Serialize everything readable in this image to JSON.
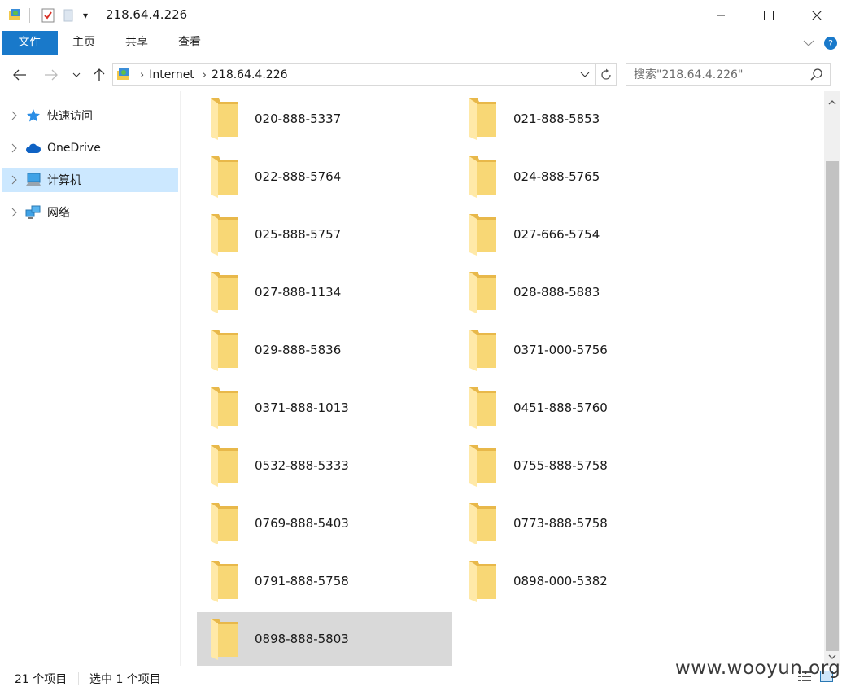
{
  "window": {
    "title": "218.64.4.226",
    "quick_access_dropdown": "▾"
  },
  "ribbon": {
    "tabs": [
      {
        "label": "文件"
      },
      {
        "label": "主页"
      },
      {
        "label": "共享"
      },
      {
        "label": "查看"
      }
    ]
  },
  "address": {
    "crumbs": [
      "Internet",
      "218.64.4.226"
    ]
  },
  "search": {
    "placeholder": "搜索\"218.64.4.226\""
  },
  "nav_pane": {
    "items": [
      {
        "label": "快速访问",
        "icon": "star-icon"
      },
      {
        "label": "OneDrive",
        "icon": "cloud-icon"
      },
      {
        "label": "计算机",
        "icon": "computer-icon",
        "selected": true
      },
      {
        "label": "网络",
        "icon": "network-icon"
      }
    ]
  },
  "folders": [
    "020-888-5337",
    "021-888-5853",
    "022-888-5764",
    "024-888-5765",
    "025-888-5757",
    "027-666-5754",
    "027-888-1134",
    "028-888-5883",
    "029-888-5836",
    "0371-000-5756",
    "0371-888-1013",
    "0451-888-5760",
    "0532-888-5333",
    "0755-888-5758",
    "0769-888-5403",
    "0773-888-5758",
    "0791-888-5758",
    "0898-000-5382",
    "0898-888-5803"
  ],
  "selected_folder_index": 18,
  "status": {
    "item_count": "21 个项目",
    "selected_count": "选中 1 个项目"
  },
  "watermark": "www.wooyun.org",
  "colors": {
    "file_tab": "#1979ca",
    "nav_selected": "#cce8ff",
    "tile_selected": "#d9d9d9",
    "folder_yellow": "#f8d775"
  }
}
